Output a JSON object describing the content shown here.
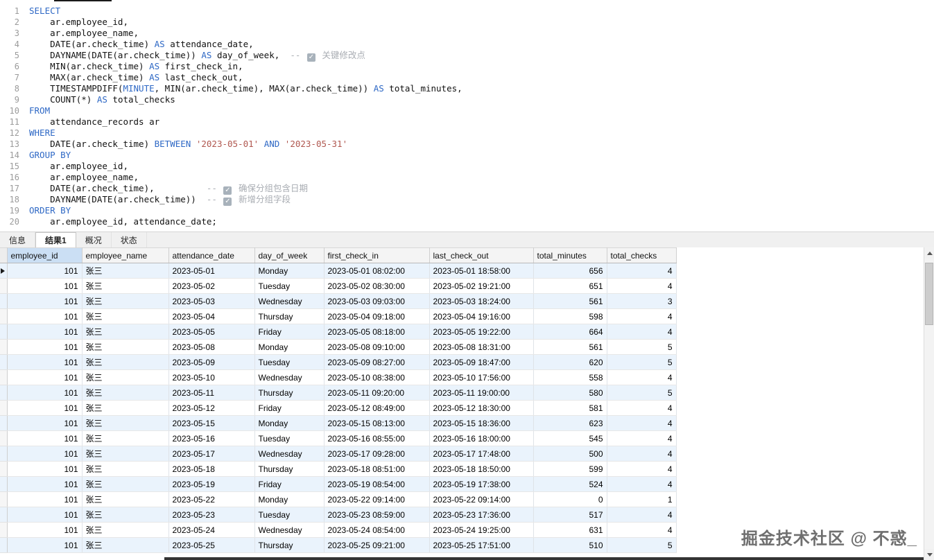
{
  "colors": {
    "keyword": "#2E68C5",
    "string": "#B0574F",
    "comment": "#A9ADB3",
    "row_alt": "#EAF3FC",
    "header_selected": "#CBDFF4"
  },
  "icons": {
    "comment_checkbox": "✓",
    "scroll_up": "▲",
    "scroll_down": "▼",
    "current_row_arrow": "▶"
  },
  "editor": {
    "lines": [
      {
        "no": "1",
        "seg": [
          [
            "kw",
            "SELECT"
          ]
        ]
      },
      {
        "no": "2",
        "seg": [
          [
            "pl",
            "    ar.employee_id,"
          ]
        ]
      },
      {
        "no": "3",
        "seg": [
          [
            "pl",
            "    ar.employee_name,"
          ]
        ]
      },
      {
        "no": "4",
        "seg": [
          [
            "pl",
            "    DATE(ar.check_time) "
          ],
          [
            "kw",
            "AS"
          ],
          [
            "pl",
            " attendance_date,"
          ]
        ]
      },
      {
        "no": "5",
        "seg": [
          [
            "pl",
            "    DAYNAME(DATE(ar.check_time)) "
          ],
          [
            "kw",
            "AS"
          ],
          [
            "pl",
            " day_of_week,  "
          ],
          [
            "com",
            "-- "
          ],
          [
            "chk",
            ""
          ],
          [
            "com",
            " 关键修改点"
          ]
        ]
      },
      {
        "no": "6",
        "seg": [
          [
            "pl",
            "    MIN(ar.check_time) "
          ],
          [
            "kw",
            "AS"
          ],
          [
            "pl",
            " first_check_in,"
          ]
        ]
      },
      {
        "no": "7",
        "seg": [
          [
            "pl",
            "    MAX(ar.check_time) "
          ],
          [
            "kw",
            "AS"
          ],
          [
            "pl",
            " last_check_out,"
          ]
        ]
      },
      {
        "no": "8",
        "seg": [
          [
            "pl",
            "    TIMESTAMPDIFF("
          ],
          [
            "kw",
            "MINUTE"
          ],
          [
            "pl",
            ", MIN(ar.check_time), MAX(ar.check_time)) "
          ],
          [
            "kw",
            "AS"
          ],
          [
            "pl",
            " total_minutes,"
          ]
        ]
      },
      {
        "no": "9",
        "seg": [
          [
            "pl",
            "    COUNT(*) "
          ],
          [
            "kw",
            "AS"
          ],
          [
            "pl",
            " total_checks"
          ]
        ]
      },
      {
        "no": "10",
        "seg": [
          [
            "kw",
            "FROM"
          ]
        ]
      },
      {
        "no": "11",
        "seg": [
          [
            "pl",
            "    attendance_records ar"
          ]
        ]
      },
      {
        "no": "12",
        "seg": [
          [
            "kw",
            "WHERE"
          ]
        ]
      },
      {
        "no": "13",
        "seg": [
          [
            "pl",
            "    DATE(ar.check_time) "
          ],
          [
            "kw",
            "BETWEEN"
          ],
          [
            "pl",
            " "
          ],
          [
            "str",
            "'2023-05-01'"
          ],
          [
            "pl",
            " "
          ],
          [
            "kw",
            "AND"
          ],
          [
            "pl",
            " "
          ],
          [
            "str",
            "'2023-05-31'"
          ]
        ]
      },
      {
        "no": "14",
        "seg": [
          [
            "kw",
            "GROUP BY"
          ]
        ]
      },
      {
        "no": "15",
        "seg": [
          [
            "pl",
            "    ar.employee_id,"
          ]
        ]
      },
      {
        "no": "16",
        "seg": [
          [
            "pl",
            "    ar.employee_name,"
          ]
        ]
      },
      {
        "no": "17",
        "seg": [
          [
            "pl",
            "    DATE(ar.check_time),          "
          ],
          [
            "com",
            "-- "
          ],
          [
            "chk",
            ""
          ],
          [
            "com",
            " 确保分组包含日期"
          ]
        ]
      },
      {
        "no": "18",
        "seg": [
          [
            "pl",
            "    DAYNAME(DATE(ar.check_time))  "
          ],
          [
            "com",
            "-- "
          ],
          [
            "chk",
            ""
          ],
          [
            "com",
            " 新增分组字段"
          ]
        ]
      },
      {
        "no": "19",
        "seg": [
          [
            "kw",
            "ORDER BY"
          ]
        ]
      },
      {
        "no": "20",
        "seg": [
          [
            "pl",
            "    ar.employee_id, attendance_date;"
          ]
        ]
      }
    ]
  },
  "result_tabs": [
    {
      "id": "info",
      "label": "信息",
      "active": false
    },
    {
      "id": "result-1",
      "label": "结果1",
      "active": true
    },
    {
      "id": "overview",
      "label": "概况",
      "active": false
    },
    {
      "id": "status",
      "label": "状态",
      "active": false
    }
  ],
  "results": {
    "columns": [
      "employee_id",
      "employee_name",
      "attendance_date",
      "day_of_week",
      "first_check_in",
      "last_check_out",
      "total_minutes",
      "total_checks"
    ],
    "rows": [
      [
        "101",
        "张三",
        "2023-05-01",
        "Monday",
        "2023-05-01 08:02:00",
        "2023-05-01 18:58:00",
        "656",
        "4"
      ],
      [
        "101",
        "张三",
        "2023-05-02",
        "Tuesday",
        "2023-05-02 08:30:00",
        "2023-05-02 19:21:00",
        "651",
        "4"
      ],
      [
        "101",
        "张三",
        "2023-05-03",
        "Wednesday",
        "2023-05-03 09:03:00",
        "2023-05-03 18:24:00",
        "561",
        "3"
      ],
      [
        "101",
        "张三",
        "2023-05-04",
        "Thursday",
        "2023-05-04 09:18:00",
        "2023-05-04 19:16:00",
        "598",
        "4"
      ],
      [
        "101",
        "张三",
        "2023-05-05",
        "Friday",
        "2023-05-05 08:18:00",
        "2023-05-05 19:22:00",
        "664",
        "4"
      ],
      [
        "101",
        "张三",
        "2023-05-08",
        "Monday",
        "2023-05-08 09:10:00",
        "2023-05-08 18:31:00",
        "561",
        "5"
      ],
      [
        "101",
        "张三",
        "2023-05-09",
        "Tuesday",
        "2023-05-09 08:27:00",
        "2023-05-09 18:47:00",
        "620",
        "5"
      ],
      [
        "101",
        "张三",
        "2023-05-10",
        "Wednesday",
        "2023-05-10 08:38:00",
        "2023-05-10 17:56:00",
        "558",
        "4"
      ],
      [
        "101",
        "张三",
        "2023-05-11",
        "Thursday",
        "2023-05-11 09:20:00",
        "2023-05-11 19:00:00",
        "580",
        "5"
      ],
      [
        "101",
        "张三",
        "2023-05-12",
        "Friday",
        "2023-05-12 08:49:00",
        "2023-05-12 18:30:00",
        "581",
        "4"
      ],
      [
        "101",
        "张三",
        "2023-05-15",
        "Monday",
        "2023-05-15 08:13:00",
        "2023-05-15 18:36:00",
        "623",
        "4"
      ],
      [
        "101",
        "张三",
        "2023-05-16",
        "Tuesday",
        "2023-05-16 08:55:00",
        "2023-05-16 18:00:00",
        "545",
        "4"
      ],
      [
        "101",
        "张三",
        "2023-05-17",
        "Wednesday",
        "2023-05-17 09:28:00",
        "2023-05-17 17:48:00",
        "500",
        "4"
      ],
      [
        "101",
        "张三",
        "2023-05-18",
        "Thursday",
        "2023-05-18 08:51:00",
        "2023-05-18 18:50:00",
        "599",
        "4"
      ],
      [
        "101",
        "张三",
        "2023-05-19",
        "Friday",
        "2023-05-19 08:54:00",
        "2023-05-19 17:38:00",
        "524",
        "4"
      ],
      [
        "101",
        "张三",
        "2023-05-22",
        "Monday",
        "2023-05-22 09:14:00",
        "2023-05-22 09:14:00",
        "0",
        "1"
      ],
      [
        "101",
        "张三",
        "2023-05-23",
        "Tuesday",
        "2023-05-23 08:59:00",
        "2023-05-23 17:36:00",
        "517",
        "4"
      ],
      [
        "101",
        "张三",
        "2023-05-24",
        "Wednesday",
        "2023-05-24 08:54:00",
        "2023-05-24 19:25:00",
        "631",
        "4"
      ],
      [
        "101",
        "张三",
        "2023-05-25",
        "Thursday",
        "2023-05-25 09:21:00",
        "2023-05-25 17:51:00",
        "510",
        "5"
      ]
    ]
  },
  "watermark": "掘金技术社区 @ 不惑_"
}
